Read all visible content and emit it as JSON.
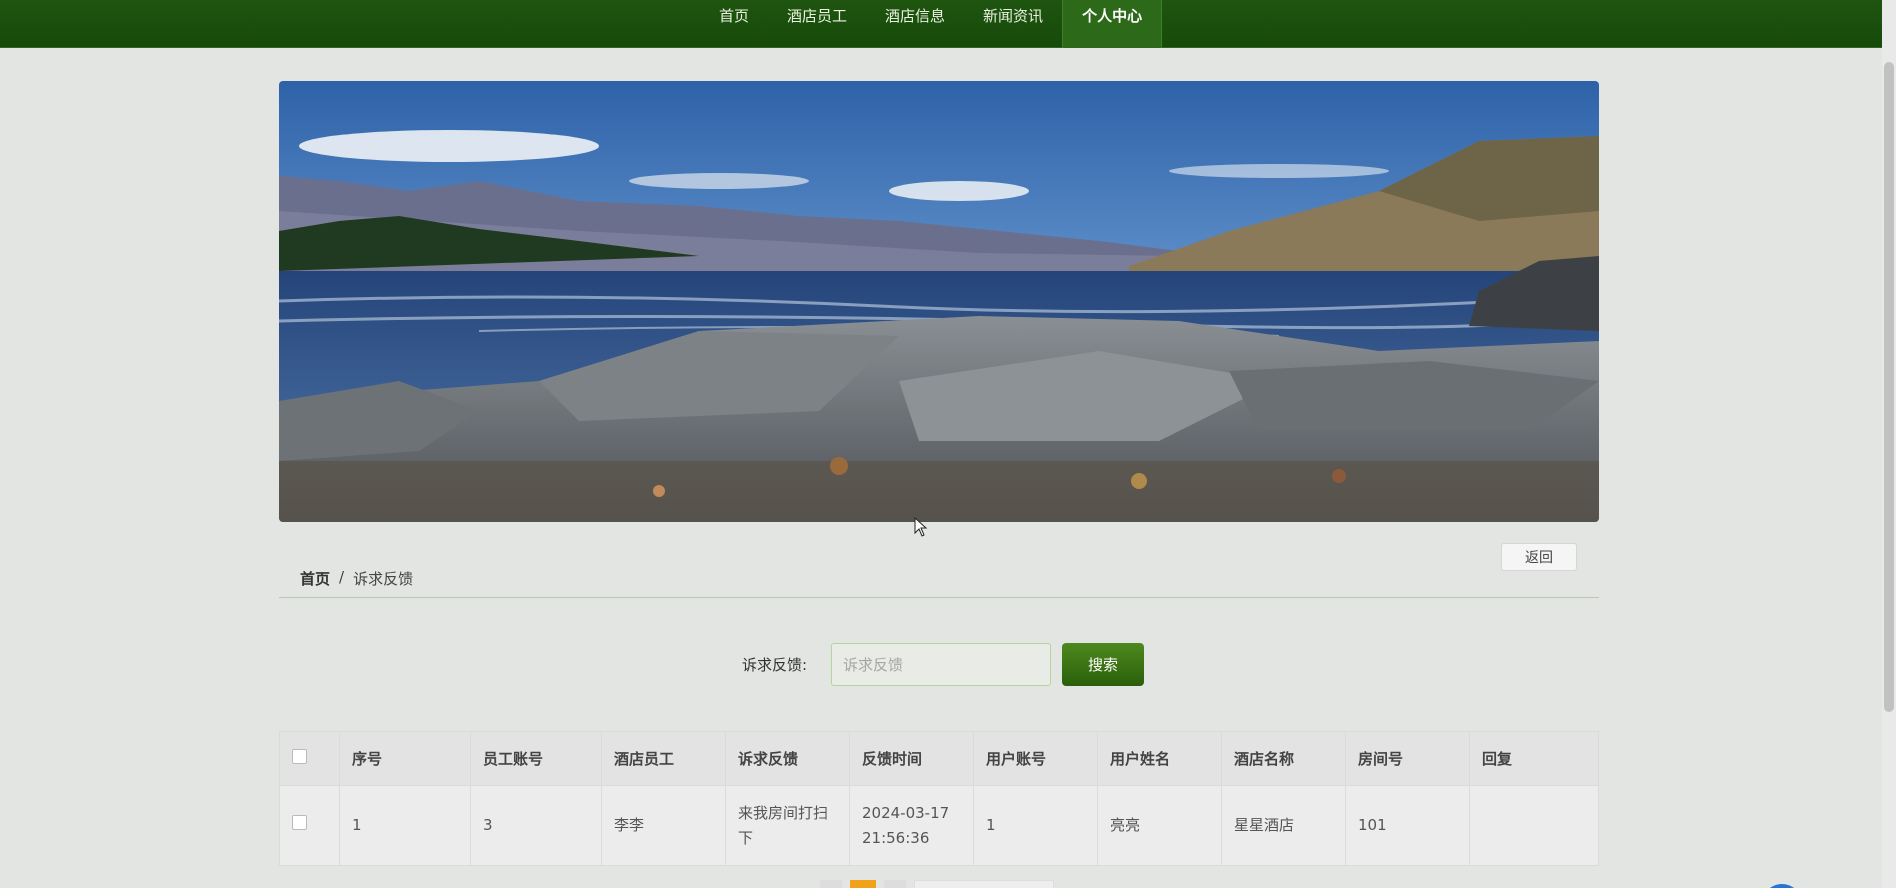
{
  "nav": {
    "items": [
      {
        "label": "首页"
      },
      {
        "label": "酒店员工"
      },
      {
        "label": "酒店信息"
      },
      {
        "label": "新闻资讯"
      },
      {
        "label": "个人中心"
      }
    ],
    "active_index": 4
  },
  "breadcrumb": {
    "home": "首页",
    "separator": "/",
    "current": "诉求反馈"
  },
  "back_button": "返回",
  "search": {
    "label": "诉求反馈:",
    "placeholder": "诉求反馈",
    "value": "",
    "button": "搜索"
  },
  "table": {
    "headers": [
      "序号",
      "员工账号",
      "酒店员工",
      "诉求反馈",
      "反馈时间",
      "用户账号",
      "用户姓名",
      "酒店名称",
      "房间号",
      "回复"
    ],
    "rows": [
      [
        "1",
        "3",
        "李李",
        "来我房间打扫下",
        "2024-03-17 21:56:36",
        "1",
        "亮亮",
        "星星酒店",
        "101",
        ""
      ]
    ]
  },
  "colors": {
    "nav_bg": "#1f5410",
    "accent": "#3b7a15",
    "page_bg": "#e2e5e1"
  }
}
